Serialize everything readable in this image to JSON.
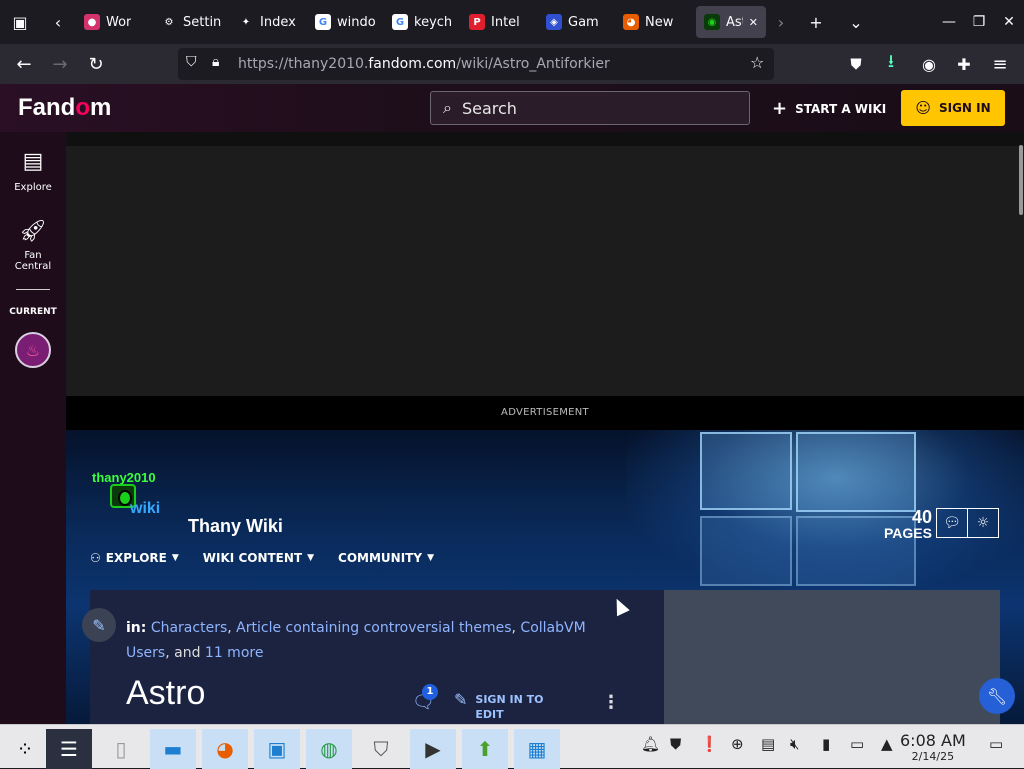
{
  "browser": {
    "tabs": [
      {
        "label": "Wor",
        "icon": "purple-circle-icon"
      },
      {
        "label": "Settin",
        "icon": "gear-icon"
      },
      {
        "label": "Index",
        "icon": "index-icon"
      },
      {
        "label": "windo",
        "icon": "google-icon"
      },
      {
        "label": "keych",
        "icon": "google-icon"
      },
      {
        "label": "Intel",
        "icon": "p-logo-icon"
      },
      {
        "label": "Gam",
        "icon": "game-icon"
      },
      {
        "label": "New",
        "icon": "firefox-icon"
      },
      {
        "label": "Ast",
        "icon": "eye-logo-icon",
        "active": true
      }
    ],
    "url_prefix": "https://thany2010.",
    "url_domain": "fandom.com",
    "url_path": "/wiki/Astro_Antiforkier"
  },
  "fandom": {
    "logo_a": "Fand",
    "logo_o": "o",
    "logo_b": "m",
    "search_placeholder": "Search",
    "start_wiki": "START A WIKI",
    "sign_in": "SIGN IN"
  },
  "sidebar": {
    "explore": "Explore",
    "fan_central_1": "Fan",
    "fan_central_2": "Central",
    "current": "CURRENT"
  },
  "ad": {
    "label": "ADVERTISEMENT"
  },
  "wiki": {
    "logo_top": "thany2010",
    "logo_bottom": "wiki",
    "name": "Thany Wiki",
    "pages_count": "40",
    "pages_label": "PAGES",
    "nav": [
      "EXPLORE",
      "WIKI CONTENT",
      "COMMUNITY"
    ]
  },
  "article": {
    "in_label": "in:",
    "categories": [
      "Characters",
      "Article containing controversial themes",
      "CollabVM Users"
    ],
    "and_label": "and",
    "more": "11 more",
    "title": "Astro",
    "comment_count": "1",
    "sign_in_edit_1": "SIGN IN TO",
    "sign_in_edit_2": "EDIT"
  },
  "taskbar": {
    "time": "6:08 AM",
    "date": "2/14/25"
  }
}
